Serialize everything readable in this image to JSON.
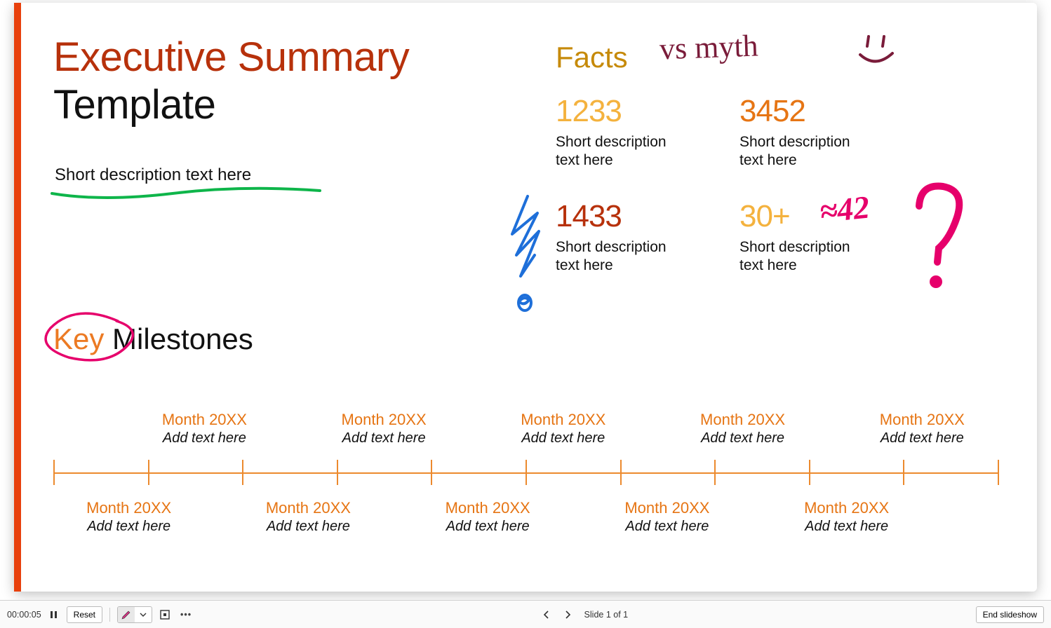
{
  "slide": {
    "title_line1": "Executive Summary",
    "title_line2": "Template",
    "subtitle": "Short description text here",
    "facts_label": "Facts",
    "facts": [
      {
        "value": "1233",
        "desc1": "Short description",
        "desc2": "text here"
      },
      {
        "value": "3452",
        "desc1": "Short description",
        "desc2": "text here"
      },
      {
        "value": "1433",
        "desc1": "Short description",
        "desc2": "text here"
      },
      {
        "value": "30+",
        "desc1": "Short description",
        "desc2": "text here"
      }
    ],
    "key_label1": "Key",
    "key_label2": " Milestones",
    "timeline_top": [
      {
        "month": "Month 20XX",
        "text": "Add text here"
      },
      {
        "month": "Month 20XX",
        "text": "Add text here"
      },
      {
        "month": "Month 20XX",
        "text": "Add text here"
      },
      {
        "month": "Month 20XX",
        "text": "Add text here"
      },
      {
        "month": "Month 20XX",
        "text": "Add text here"
      }
    ],
    "timeline_bottom": [
      {
        "month": "Month 20XX",
        "text": "Add text here"
      },
      {
        "month": "Month 20XX",
        "text": "Add text here"
      },
      {
        "month": "Month 20XX",
        "text": "Add text here"
      },
      {
        "month": "Month 20XX",
        "text": "Add text here"
      },
      {
        "month": "Month 20XX",
        "text": "Add text here"
      }
    ],
    "annotations": {
      "vs_myth": "vs myth",
      "approx_42": "≈42"
    }
  },
  "toolbar": {
    "timer": "00:00:05",
    "reset": "Reset",
    "slide_indicator": "Slide 1 of 1",
    "end": "End slideshow"
  }
}
